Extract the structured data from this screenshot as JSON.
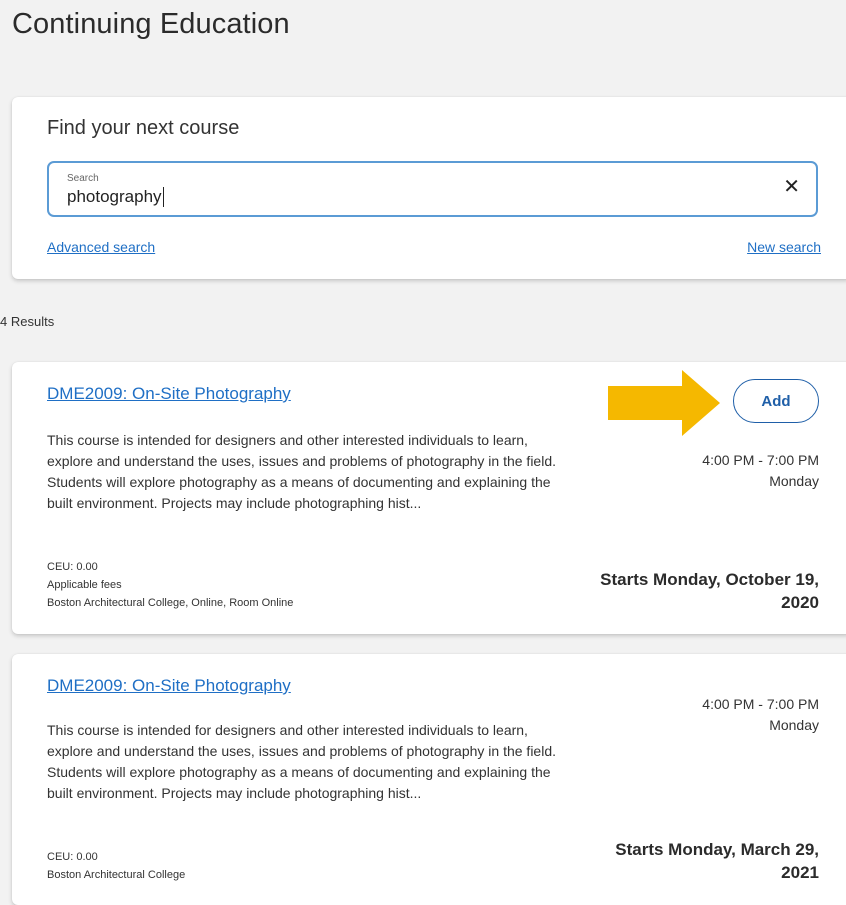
{
  "page": {
    "title": "Continuing Education"
  },
  "search": {
    "heading": "Find your next course",
    "label": "Search",
    "value": "photography",
    "clear_label": "✕",
    "advanced_link": "Advanced search",
    "new_search_link": "New search"
  },
  "results": {
    "count_label": "4 Results"
  },
  "colors": {
    "link": "#1f6fc5",
    "arrow": "#f5b800",
    "focus_border": "#5b9bd5"
  },
  "courses": [
    {
      "title": "DME2009: On-Site Photography",
      "description": "This course is intended for designers and other interested individuals to learn, explore and understand the uses, issues and problems of photography in the field. Students will explore photography as a means of documenting and explaining the built environment. Projects may include photographing hist...",
      "ceu": "CEU: 0.00",
      "fees": "Applicable fees",
      "location": "Boston Architectural College, Online, Room Online",
      "time": "4:00 PM - 7:00 PM",
      "day": "Monday",
      "start": "Starts Monday, October 19, 2020",
      "add_label": "Add",
      "arrow_icon": "arrow-right-icon"
    },
    {
      "title": "DME2009: On-Site Photography",
      "description": "This course is intended for designers and other interested individuals to learn, explore and understand the uses, issues and problems of photography in the field. Students will explore photography as a means of documenting and explaining the built environment. Projects may include photographing hist...",
      "ceu": "CEU: 0.00",
      "location": "Boston Architectural College",
      "time": "4:00 PM - 7:00 PM",
      "day": "Monday",
      "start": "Starts Monday, March 29, 2021"
    }
  ]
}
